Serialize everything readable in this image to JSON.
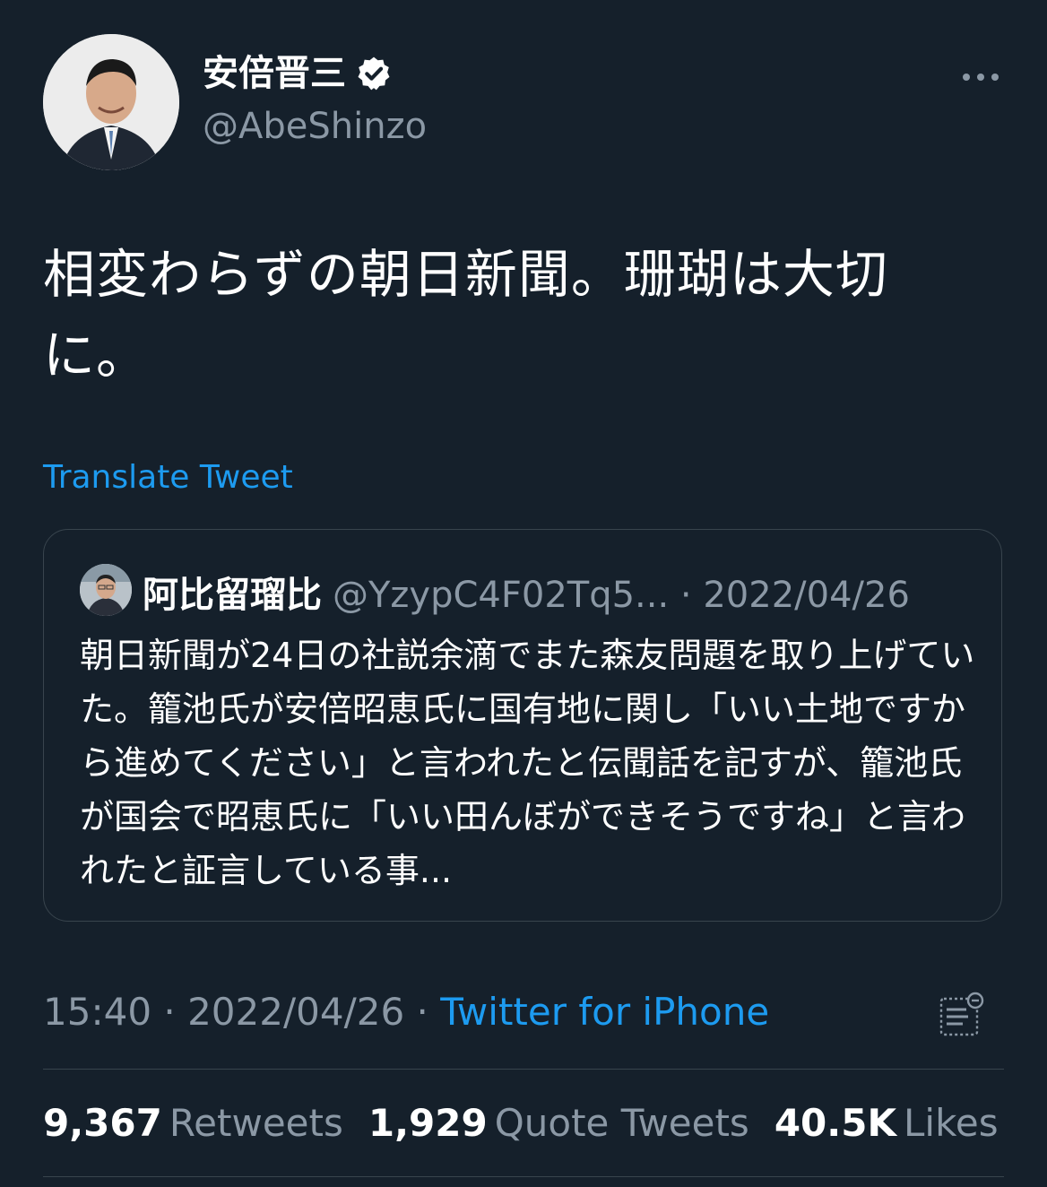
{
  "tweet": {
    "author": {
      "name": "安倍晋三",
      "handle": "@AbeShinzo",
      "verified": true
    },
    "text": "相変わらずの朝日新聞。珊瑚は大切に。",
    "translate_label": "Translate Tweet",
    "quoted": {
      "name": "阿比留瑠比",
      "handle_and_date": "@YzypC4F02Tq5... · 2022/04/26",
      "text": "朝日新聞が24日の社説余滴でまた森友問題を取り上げていた。籠池氏が安倍昭恵氏に国有地に関し「いい土地ですから進めてください」と言われたと伝聞話を記すが、籠池氏が国会で昭恵氏に「いい田んぼができそうですね」と言われたと証言している事..."
    },
    "time_date": "15:40 · 2022/04/26 · ",
    "source": "Twitter for iPhone",
    "stats": {
      "retweets_count": "9,367",
      "retweets_label": "Retweets",
      "quotes_count": "1,929",
      "quotes_label": "Quote Tweets",
      "likes_count": "40.5K",
      "likes_label": "Likes"
    }
  },
  "icons": {
    "verified": "verified-badge-icon",
    "more": "more-horizontal-icon",
    "analytics": "analytics-icon"
  },
  "colors": {
    "background": "#15202b",
    "accent": "#1d9bf0",
    "secondary_text": "#8b98a5",
    "border": "#38444d"
  }
}
